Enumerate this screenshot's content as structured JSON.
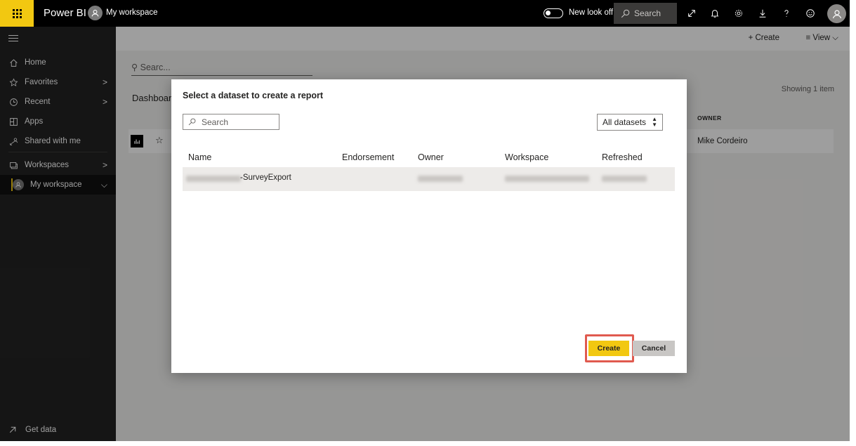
{
  "topbar": {
    "app_name": "Power BI",
    "workspace": "My workspace",
    "new_look_label": "New look off",
    "search_placeholder": "Search",
    "icons": [
      "expand-icon",
      "notification-icon",
      "settings-icon",
      "download-icon",
      "help-icon",
      "feedback-icon",
      "account-icon"
    ],
    "accent_color": "#f2c811"
  },
  "sidebar": {
    "items": [
      {
        "label": "Home",
        "icon": "home-icon"
      },
      {
        "label": "Favorites",
        "icon": "star-icon",
        "chevron": ">"
      },
      {
        "label": "Recent",
        "icon": "clock-icon",
        "chevron": ">"
      },
      {
        "label": "Apps",
        "icon": "apps-icon"
      },
      {
        "label": "Shared with me",
        "icon": "shared-icon"
      },
      {
        "label": "Workspaces",
        "icon": "workspaces-icon",
        "chevron": ">"
      },
      {
        "label": "My workspace",
        "icon": "avatar",
        "chevron": "⌵",
        "active": true
      }
    ],
    "get_data": "Get data"
  },
  "main": {
    "create_label": "+ Create",
    "view_label": "≡ View ⌵",
    "search_placeholder": "Searc...",
    "tab_label": "Dashboar",
    "showing": "Showing 1 item",
    "owner_header": "OWNER",
    "row_owner": "Mike Cordeiro"
  },
  "modal": {
    "title": "Select a dataset to create a report",
    "search_placeholder": "Search",
    "filter_selected": "All datasets",
    "columns": [
      "Name",
      "Endorsement",
      "Owner",
      "Workspace",
      "Refreshed"
    ],
    "rows": [
      {
        "name_suffix": "-SurveyExport"
      }
    ],
    "create_button": "Create",
    "cancel_button": "Cancel",
    "highlight_color": "#e05a4f"
  }
}
